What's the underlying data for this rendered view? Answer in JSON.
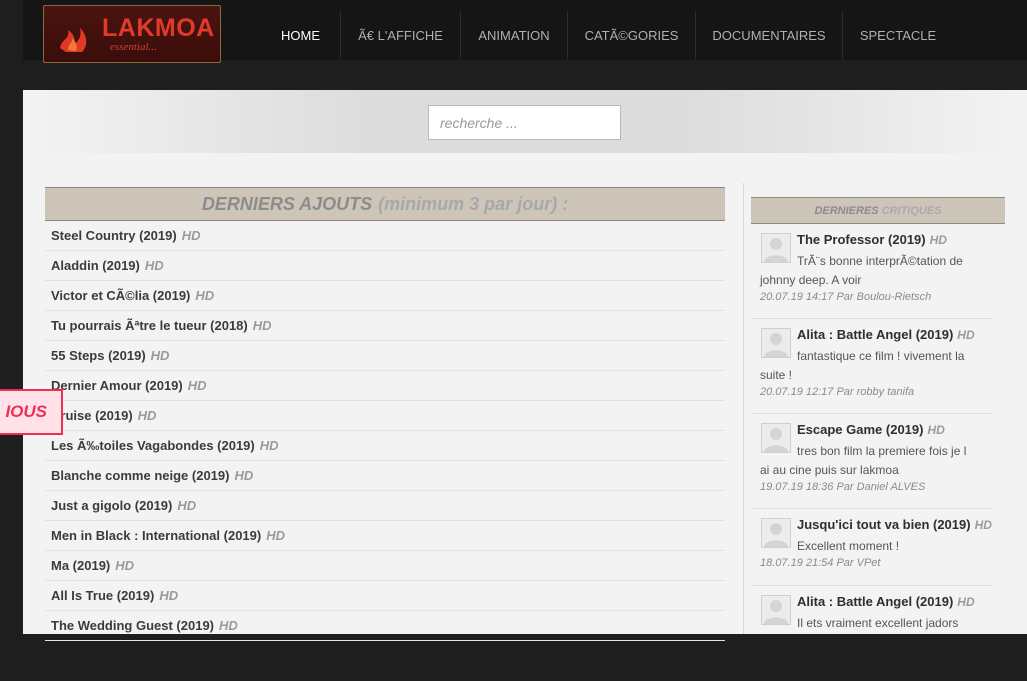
{
  "brand": {
    "name": "LAKMOA",
    "tagline": "essential..."
  },
  "nav": [
    {
      "label": "HOME",
      "active": true
    },
    {
      "label": "Ã€ L'AFFICHE",
      "active": false
    },
    {
      "label": "ANIMATION",
      "active": false
    },
    {
      "label": "CATÃ©GORIES",
      "active": false
    },
    {
      "label": "DOCUMENTAIRES",
      "active": false
    },
    {
      "label": "SPECTACLE",
      "active": false
    }
  ],
  "search": {
    "placeholder": "recherche ..."
  },
  "latest": {
    "title": "DERNIERS AJOUTS",
    "subtitle": "(minimum 3 par jour) :",
    "items": [
      {
        "title": "Steel Country (2019)",
        "badge": "HD"
      },
      {
        "title": "Aladdin (2019)",
        "badge": "HD"
      },
      {
        "title": "Victor et CÃ©lia (2019)",
        "badge": "HD"
      },
      {
        "title": "Tu pourrais Ãªtre le tueur (2018)",
        "badge": "HD"
      },
      {
        "title": "55 Steps (2019)",
        "badge": "HD"
      },
      {
        "title": "Dernier Amour (2019)",
        "badge": "HD"
      },
      {
        "title": "Cruise (2019)",
        "badge": "HD"
      },
      {
        "title": "Les Ã‰toiles Vagabondes (2019)",
        "badge": "HD"
      },
      {
        "title": "Blanche comme neige (2019)",
        "badge": "HD"
      },
      {
        "title": "Just a gigolo (2019)",
        "badge": "HD"
      },
      {
        "title": "Men in Black : International (2019)",
        "badge": "HD"
      },
      {
        "title": "Ma (2019)",
        "badge": "HD"
      },
      {
        "title": "All Is True (2019)",
        "badge": "HD"
      },
      {
        "title": "The Wedding Guest (2019)",
        "badge": "HD"
      }
    ]
  },
  "reviews": {
    "title_dark": "DERNIERES",
    "title_light": "CRITIQUES",
    "items": [
      {
        "title": "The Professor (2019)",
        "badge": "HD",
        "text": "TrÃ¨s bonne interprÃ©tation de johnny deep. A voir",
        "meta": "20.07.19 14:17 Par Boulou-Rietsch"
      },
      {
        "title": "Alita : Battle Angel (2019)",
        "badge": "HD",
        "text": "fantastique ce film ! vivement la suite !",
        "meta": "20.07.19 12:17 Par robby tanifa"
      },
      {
        "title": "Escape Game (2019)",
        "badge": "HD",
        "text": "tres bon film la premiere fois je l ai au cine puis sur lakmoa",
        "meta": "19.07.19 18:36 Par Daniel ALVES"
      },
      {
        "title": "Jusqu'ici tout va bien (2019)",
        "badge": "HD",
        "text": "Excellent moment !",
        "meta": "18.07.19 21:54 Par VPet"
      },
      {
        "title": "Alita : Battle Angel (2019)",
        "badge": "HD",
        "text": "Il ets vraiment excellent jadors",
        "meta": ""
      }
    ]
  },
  "ribbon": {
    "label": "IOUS"
  },
  "colors": {
    "accent": "#e23a2a",
    "ribbon": "#ef2d57",
    "header_bg": "#ccc5b8"
  }
}
